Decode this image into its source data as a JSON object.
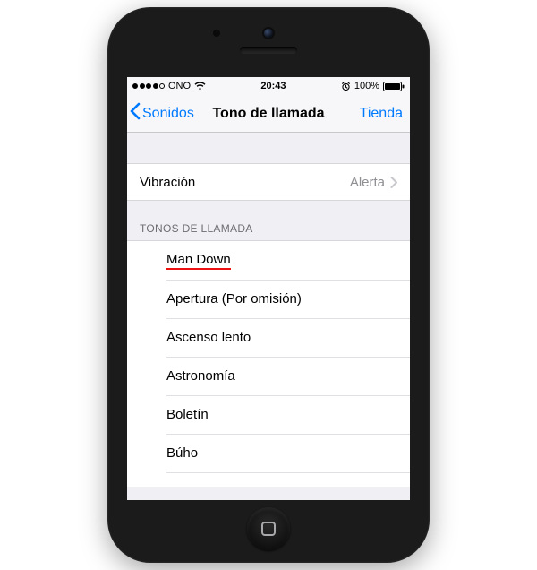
{
  "status": {
    "carrier": "ONO",
    "time": "20:43",
    "battery_pct": "100%"
  },
  "nav": {
    "back_label": "Sonidos",
    "title": "Tono de llamada",
    "right_label": "Tienda"
  },
  "vibration": {
    "label": "Vibración",
    "value": "Alerta"
  },
  "section_header": "TONOS DE LLAMADA",
  "ringtones": {
    "r0": "Man Down",
    "r1": "Apertura (Por omisión)",
    "r2": "Ascenso lento",
    "r3": "Astronomía",
    "r4": "Boletín",
    "r5": "Búho"
  }
}
